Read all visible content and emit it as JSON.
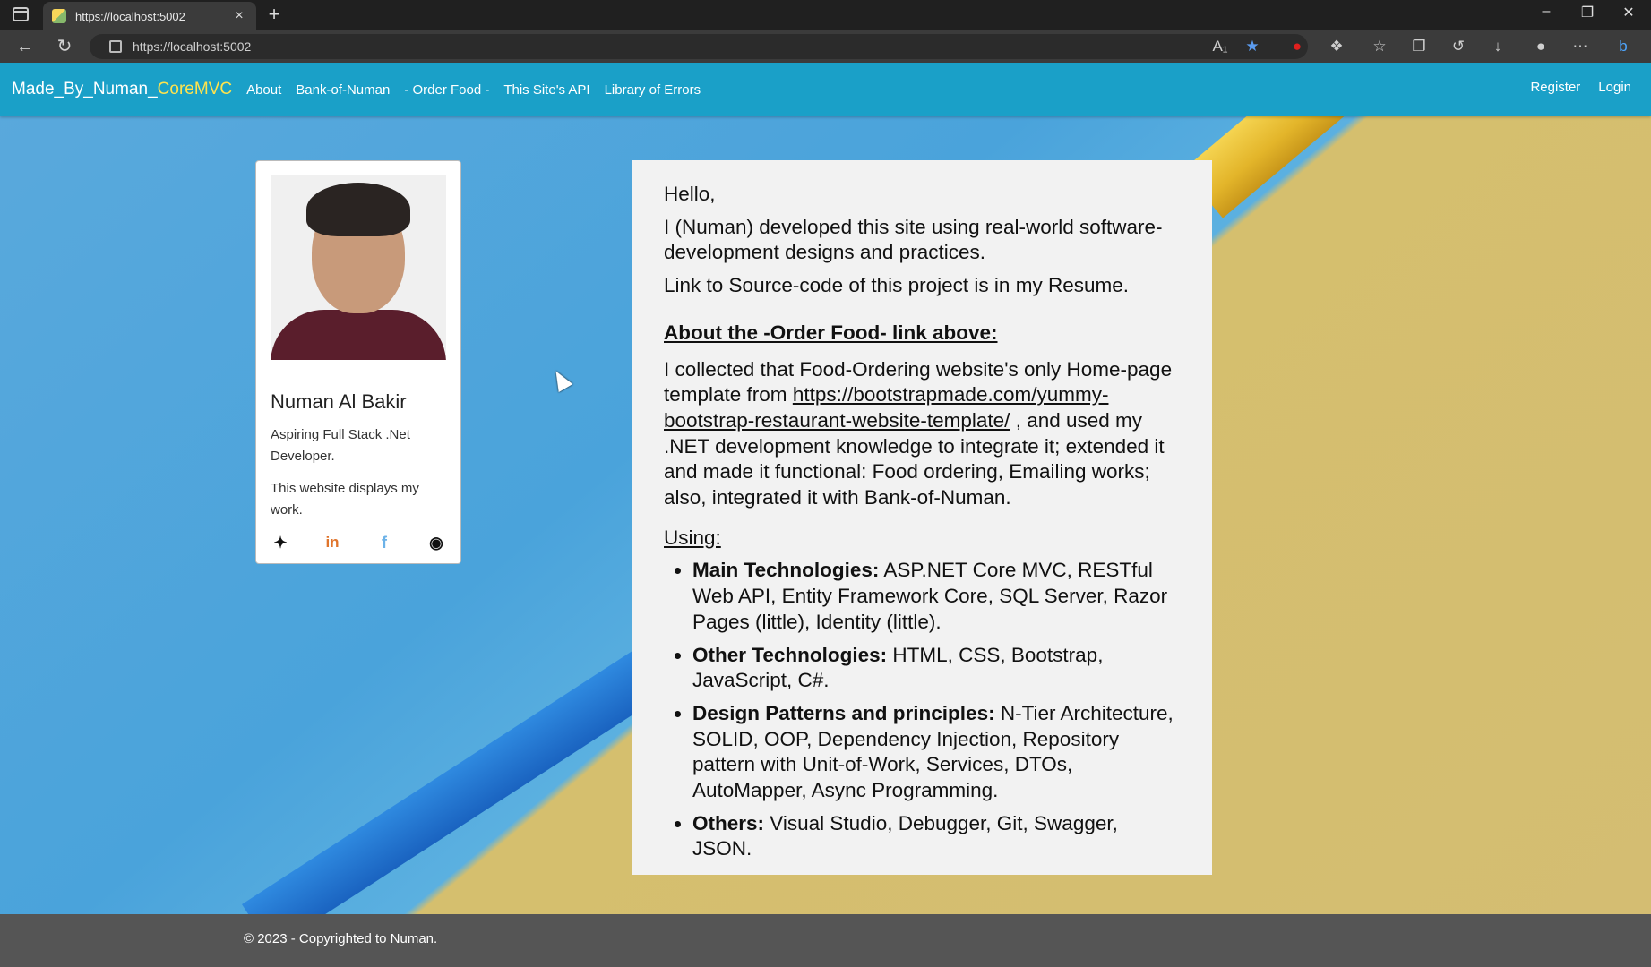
{
  "browser": {
    "tab_title": "https://localhost:5002",
    "url": "https://localhost:5002",
    "new_tab_glyph": "+",
    "tab_close_glyph": "×"
  },
  "navbar": {
    "brand_prefix": "Made_By_Numan_",
    "brand_accent": "CoreMVC",
    "links": [
      "About",
      "Bank-of-Numan",
      "- Order Food -",
      "This Site's API",
      "Library of Errors"
    ],
    "right_links": [
      "Register",
      "Login"
    ]
  },
  "profile": {
    "name": "Numan Al Bakir",
    "tagline": "Aspiring Full Stack .Net Developer.",
    "description": "This website displays my work.",
    "social_icons": [
      "twitter-icon",
      "linkedin-icon",
      "facebook-icon",
      "github-icon"
    ]
  },
  "content": {
    "greeting": "Hello,",
    "intro": "I (Numan) developed this site using real-world software-development designs and practices.",
    "source_note": "Link to Source-code of this project is in my Resume.",
    "order_heading": "About the -Order Food- link above:",
    "order_text_1": "I collected that Food-Ordering website's only Home-page template from",
    "order_link": "https://bootstrapmade.com/yummy-bootstrap-restaurant-website-template/",
    "order_text_2": ", and used my .NET development knowledge to integrate it; extended it and made it functional: Food ordering, Emailing works; also, integrated it with Bank-of-Numan.",
    "using_label": "Using:",
    "items": [
      {
        "label": "Main Technologies:",
        "text": "ASP.NET Core MVC, RESTful Web API, Entity Framework Core, SQL Server, Razor Pages (little), Identity (little)."
      },
      {
        "label": "Other Technologies:",
        "text": "HTML, CSS, Bootstrap, JavaScript, C#."
      },
      {
        "label": "Design Patterns and principles:",
        "text": "N-Tier Architecture, SOLID, OOP, Dependency Injection, Repository pattern with Unit-of-Work, Services, DTOs, AutoMapper, Async Programming."
      },
      {
        "label": "Others:",
        "text": "Visual Studio, Debugger, Git, Swagger, JSON."
      }
    ]
  },
  "footer": {
    "text": "© 2023 - Copyrighted to Numan."
  },
  "colors": {
    "navbar": "#1aa0c8",
    "brand_accent": "#ffe34d",
    "footer": "#555555"
  }
}
